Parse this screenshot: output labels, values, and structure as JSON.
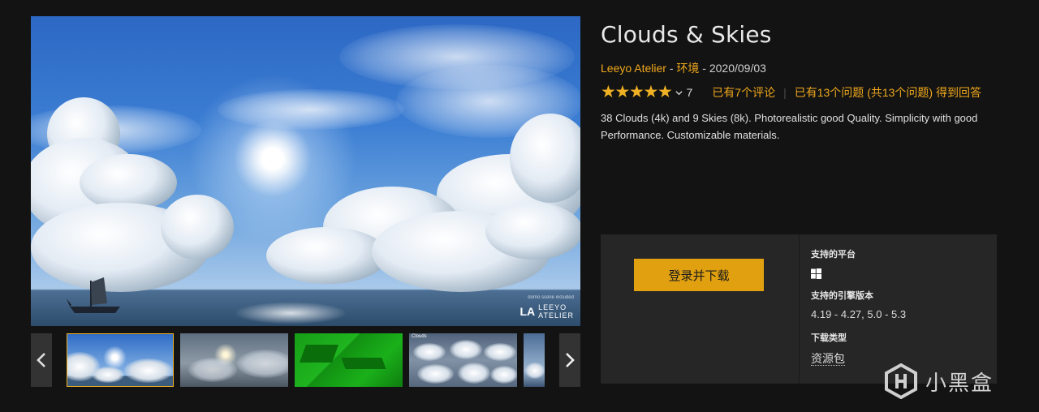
{
  "product": {
    "title": "Clouds & Skies",
    "publisher": "Leeyo Atelier",
    "category": "环境",
    "date": "2020/09/03",
    "meta_sep1": " - ",
    "meta_sep2": " - ",
    "rating_stars": 5,
    "rating_count": "7",
    "reviews_link": "已有7个评论",
    "questions_link": "已有13个问题 (共13个问题) 得到回答",
    "description": "38 Clouds (4k) and 9 Skies (8k). Photorealistic good Quality. Simplicity with good Performance. Customizable materials."
  },
  "gallery": {
    "main_image_caption": "domo scene included",
    "main_image_logo_mark": "LA",
    "main_image_logo_line1": "LEEYO",
    "main_image_logo_line2": "ATELIER",
    "thumb4_label": "Clouds",
    "selected_index": 0
  },
  "buybox": {
    "login_button": "登录并下载",
    "platforms_label": "支持的平台",
    "platform_icon": "windows-icon",
    "engine_label": "支持的引擎版本",
    "engine_versions": "4.19 - 4.27, 5.0 - 5.3",
    "download_type_label": "下载类型",
    "download_type": "资源包"
  },
  "site_watermark": "小黑盒",
  "colors": {
    "accent": "#f0a81c",
    "button": "#e0a010",
    "background": "#131313",
    "panel": "#262626"
  }
}
